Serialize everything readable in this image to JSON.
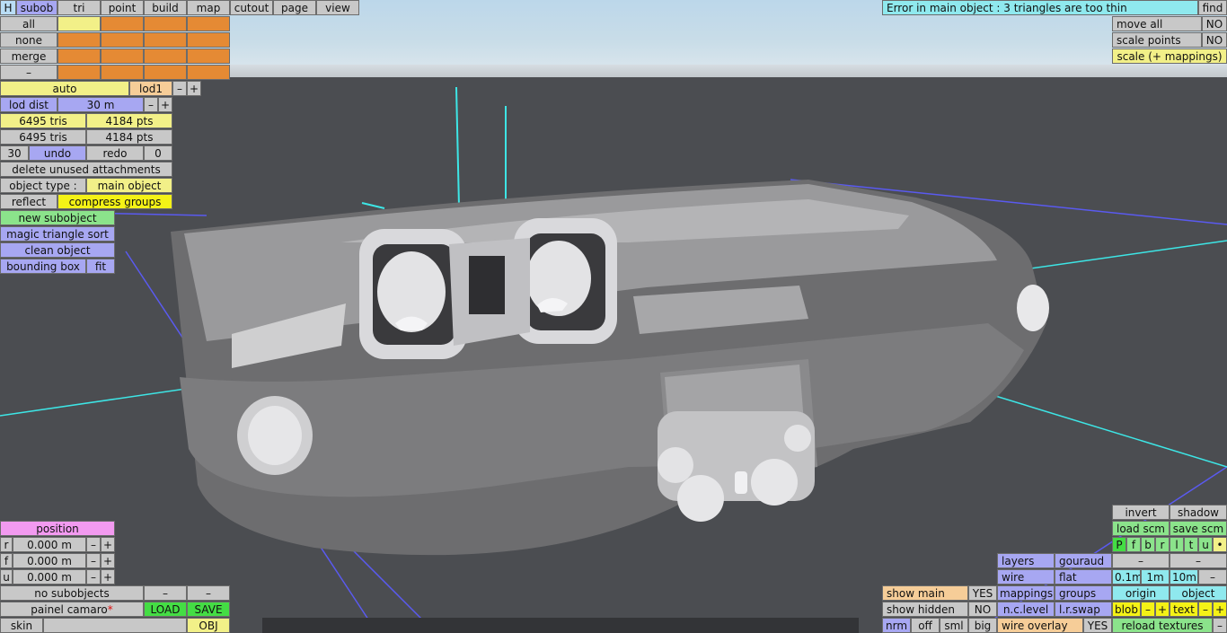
{
  "menu": {
    "h": "H",
    "subob": "subob",
    "tri": "tri",
    "point": "point",
    "build": "build",
    "map": "map",
    "cutout": "cutout",
    "page": "page",
    "view": "view"
  },
  "status": {
    "error": "Error in main object : 3 triangles are too thin",
    "find": "find"
  },
  "right_top": {
    "move_all": "move all",
    "move_all_val": "NO",
    "scale_points": "scale points",
    "scale_points_val": "NO",
    "scale_mappings": "scale (+ mappings)"
  },
  "select": {
    "all": "all",
    "none": "none",
    "merge": "merge",
    "minus": "–"
  },
  "lod": {
    "auto": "auto",
    "lod1": "lod1",
    "minus": "–",
    "plus": "+",
    "dist_label": "lod dist",
    "dist_value": "30 m"
  },
  "stats": {
    "tris1": "6495 tris",
    "pts1": "4184 pts",
    "tris2": "6495 tris",
    "pts2": "4184 pts"
  },
  "undo": {
    "count": "30",
    "undo": "undo",
    "redo": "redo",
    "redo_count": "0"
  },
  "actions": {
    "delete_unused": "delete unused attachments",
    "object_type_label": "object type :",
    "object_type_value": "main object",
    "reflect": "reflect",
    "compress": "compress groups",
    "new_subobject": "new subobject",
    "magic_sort": "magic triangle sort",
    "clean_object": "clean object",
    "bounding_box": "bounding box",
    "fit": "fit"
  },
  "position": {
    "title": "position",
    "rows": [
      {
        "axis": "r",
        "value": "0.000 m"
      },
      {
        "axis": "f",
        "value": "0.000 m"
      },
      {
        "axis": "u",
        "value": "0.000 m"
      }
    ],
    "minus": "–",
    "plus": "+"
  },
  "file": {
    "no_subobjects": "no subobjects",
    "minus": "–",
    "name": "painel camaro",
    "asterisk": "*",
    "load": "LOAD",
    "save": "SAVE",
    "skin": "skin",
    "obj": "OBJ"
  },
  "view_panel": {
    "show_main": "show main",
    "show_main_val": "YES",
    "show_hidden": "show hidden",
    "show_hidden_val": "NO",
    "nrm": "nrm",
    "off": "off",
    "sml": "sml",
    "big": "big",
    "layers": "layers",
    "gouraud": "gouraud",
    "wire": "wire",
    "flat": "flat",
    "mappings": "mappings",
    "groups": "groups",
    "nc_level": "n.c.level",
    "lr_swap": "l.r.swap",
    "wire_overlay": "wire overlay",
    "wire_overlay_val": "YES"
  },
  "right_bottom": {
    "invert": "invert",
    "shadow": "shadow",
    "load_scm": "load scm",
    "save_scm": "save scm",
    "letters": [
      "P",
      "f",
      "b",
      "r",
      "l",
      "t",
      "u",
      "•"
    ],
    "minus": "–",
    "d01": "0.1m",
    "d1": "1m",
    "d10": "10m",
    "origin": "origin",
    "object": "object",
    "blob": "blob",
    "plus": "+",
    "text": "text",
    "reload_textures": "reload textures"
  },
  "colors": {
    "yellow": "#f2f088",
    "orange": "#e58a34",
    "purple": "#a7a7f2",
    "green": "#8be38b",
    "pink": "#f29af0",
    "cyan": "#8fe9ee"
  }
}
